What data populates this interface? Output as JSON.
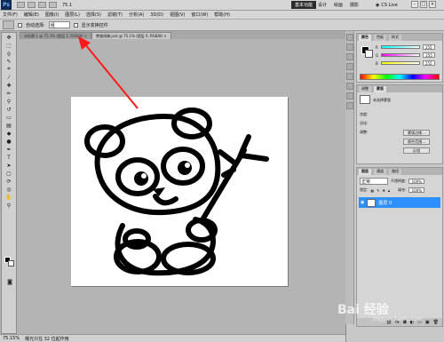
{
  "appbar": {
    "logo": "Ps",
    "zoom": "75.1",
    "workspaces": [
      "基本功能",
      "设计",
      "绘画",
      "摄影"
    ],
    "cs_live": "CS Live",
    "window_buttons": [
      "–",
      "□",
      "×"
    ]
  },
  "menu": [
    "文件(F)",
    "编辑(E)",
    "图像(I)",
    "图层(L)",
    "选择(S)",
    "滤镜(T)",
    "分析(A)",
    "3D(D)",
    "视图(V)",
    "窗口(W)",
    "帮助(H)"
  ],
  "options": {
    "auto_select_label": "自动选择:",
    "auto_select_value": "组",
    "show_transform": "显示变换控件"
  },
  "tabs": [
    {
      "label": "未标题-1 @ 75.1% (图层 1, RGB/8) ×"
    },
    {
      "label": "熊猫线稿.psd @ 75.1% (图层 0, RGB/8) ×"
    }
  ],
  "status": {
    "zoom": "75.15%",
    "doc": "曝光只在 32 位起作用"
  },
  "color_panel": {
    "tabs": [
      "颜色",
      "色板",
      "样式"
    ],
    "r": "255",
    "g": "255",
    "b": "255",
    "r_label": "R",
    "g_label": "G",
    "b_label": "B"
  },
  "adjust_panel": {
    "tabs": [
      "调整",
      "蒙版"
    ],
    "title": "未选择蒙版",
    "density": "浓度:",
    "feather": "羽化:",
    "refine": "调整:",
    "btn_edge": "蒙版边缘...",
    "btn_range": "颜色范围...",
    "btn_invert": "反相"
  },
  "layers_panel": {
    "tabs": [
      "图层",
      "通道",
      "路径"
    ],
    "mode": "正常",
    "opacity_label": "不透明度:",
    "opacity": "100%",
    "lock_label": "锁定:",
    "fill_label": "填充:",
    "fill": "100%",
    "layer_name": "图层 0"
  },
  "watermark": {
    "main": "Bai 经验",
    "sub": "jingyan.baidu.com"
  },
  "colors": {
    "arrow": "#ff1a1a",
    "selected_layer": "#2f8fff"
  }
}
